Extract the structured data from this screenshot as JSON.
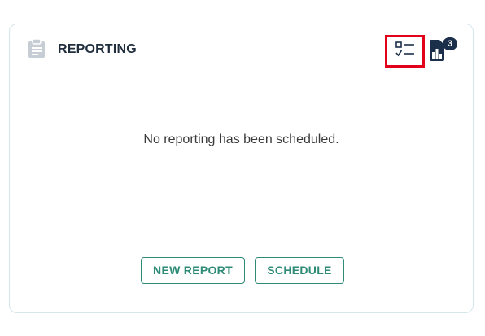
{
  "card": {
    "title": "REPORTING",
    "header_icon": "clipboard-icon",
    "empty_message": "No reporting has been scheduled.",
    "actions": {
      "checklist_icon": "checklist-icon",
      "reports_icon": "report-file-icon",
      "reports_badge_count": "3"
    },
    "buttons": {
      "new_report": "NEW REPORT",
      "schedule": "SCHEDULE"
    }
  },
  "colors": {
    "accent_teal": "#2e8b77",
    "badge_navy": "#1c2f4a",
    "highlight_red": "#e2001a",
    "icon_gray": "#c7cdd4",
    "border": "#d6e6ec"
  }
}
